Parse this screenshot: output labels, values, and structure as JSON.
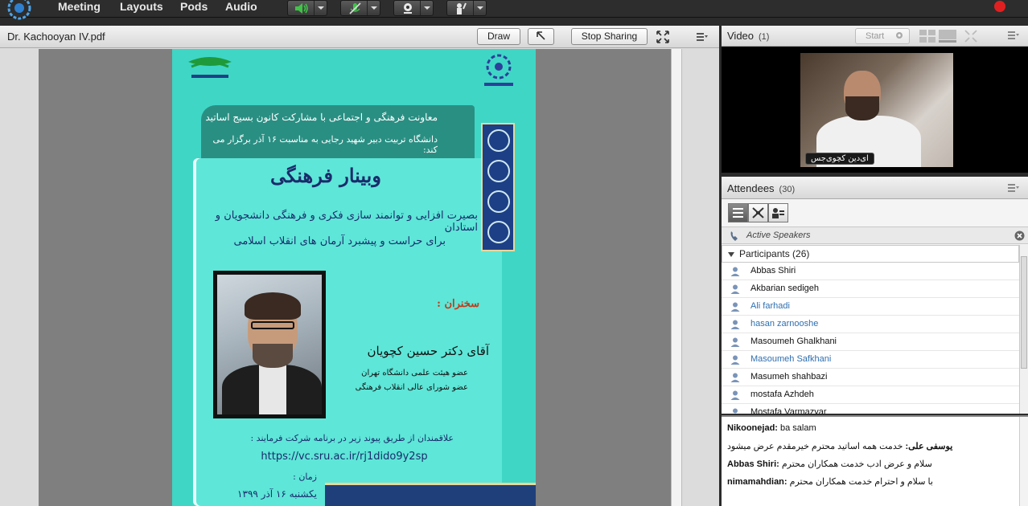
{
  "menu": {
    "items": [
      "Meeting",
      "Layouts",
      "Pods",
      "Audio"
    ]
  },
  "colors": {
    "record": "#e02020",
    "speaker_green": "#3fc447",
    "link_blue": "#2f6fb0",
    "poster_teal": "#3fd6c6"
  },
  "share_pod": {
    "title": "Dr. Kachooyan IV.pdf",
    "draw_label": "Draw",
    "stop_sharing_label": "Stop Sharing"
  },
  "poster": {
    "line1": "معاونت فرهنگی و اجتماعی با مشارکت کانون بسیج اساتید",
    "line2": "دانشگاه تربیت دبیر شهید رجایی به مناسبت ۱۶ آذر برگزار می کند:",
    "title": "وبینار فرهنگی",
    "subtitle1": "بصیرت افزایی و توانمند سازی فکری و فرهنگی دانشجویان و استادان",
    "subtitle2": "برای حراست و پیشبرد آرمان های انقلاب اسلامی",
    "speakers_label": "سخنران :",
    "speaker_name": "آقای دکتر حسین کچویان",
    "role1": "عضو هیئت علمی دانشگاه تهران",
    "role2": "عضو شورای عالی انقلاب فرهنگی",
    "invite": "علاقمندان از طریق پیوند زیر در برنامه شرکت فرمایند :",
    "url": "https://vc.sru.ac.ir/rj1dido9y2sp",
    "time_label": "زمان :",
    "date": "یکشنبه ۱۶ آذر ۱۳۹۹"
  },
  "video_pod": {
    "title": "Video",
    "count": "(1)",
    "start_label": "Start",
    "feed_name": "ای‌دین کچوی‌جس"
  },
  "attendees_pod": {
    "title": "Attendees",
    "count": "(30)",
    "active_speakers_label": "Active Speakers",
    "participants_label": "Participants (26)",
    "participants": [
      {
        "name": "Abbas Shiri",
        "highlight": false
      },
      {
        "name": "Akbarian sedigeh",
        "highlight": false
      },
      {
        "name": "Ali farhadi",
        "highlight": true
      },
      {
        "name": "hasan zarnooshe",
        "highlight": true
      },
      {
        "name": "Masoumeh Ghalkhani",
        "highlight": false
      },
      {
        "name": "Masoumeh Safkhani",
        "highlight": true
      },
      {
        "name": "Masumeh shahbazi",
        "highlight": false
      },
      {
        "name": "mostafa Azhdeh",
        "highlight": false
      },
      {
        "name": "Mostafa Varmazyar",
        "highlight": false
      }
    ]
  },
  "chat": {
    "messages": [
      {
        "sender": "Nikoonejad:",
        "text": "ba salam"
      },
      {
        "sender": "یوسفی علی:",
        "text": "خدمت همه اساتید محترم خیرمقدم عرض میشود"
      },
      {
        "sender": "Abbas Shiri:",
        "text": "سلام و عرض ادب خدمت همکاران محترم"
      },
      {
        "sender": "nimamahdian:",
        "text": "با سلام و احترام خدمت همکاران محترم"
      }
    ]
  }
}
